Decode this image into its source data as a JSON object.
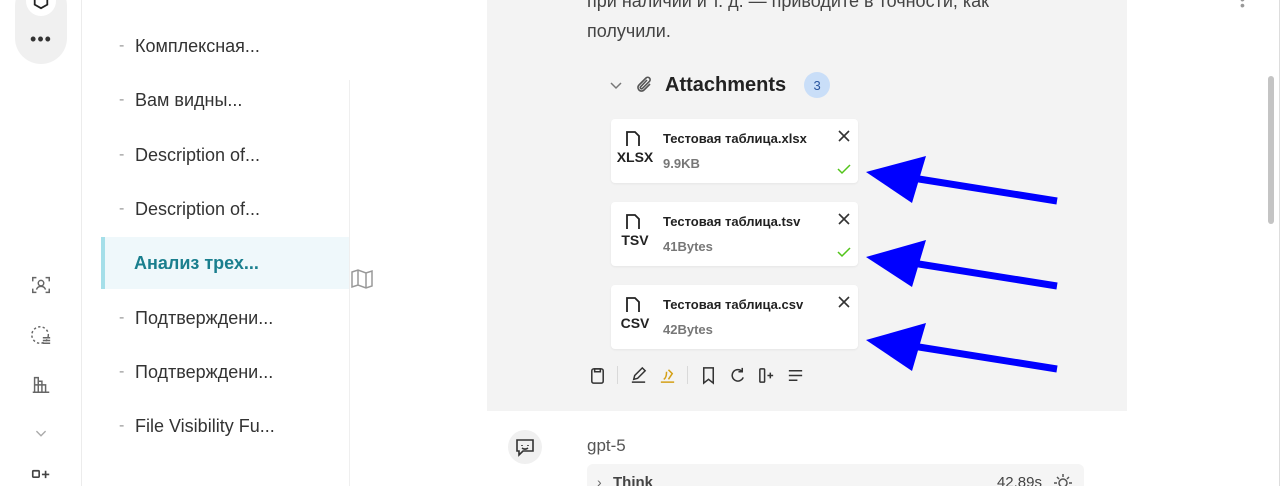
{
  "sidebar": {
    "items": [
      {
        "label": "Комплексная..."
      },
      {
        "label": "Вам видны..."
      },
      {
        "label": "Description of..."
      },
      {
        "label": "Description of..."
      },
      {
        "label": "Анализ трех..."
      },
      {
        "label": "Подтверждени..."
      },
      {
        "label": "Подтверждени..."
      },
      {
        "label": "File Visibility Fu..."
      }
    ],
    "active_index": 4
  },
  "message": {
    "text_line1": "при наличии и т. д. — приводите в точности, как",
    "text_line2": "получили."
  },
  "attachments": {
    "title": "Attachments",
    "count": "3",
    "files": [
      {
        "ext": "XLSX",
        "name": "Тестовая таблица.xlsx",
        "size": "9.9KB",
        "uploaded": true
      },
      {
        "ext": "TSV",
        "name": "Тестовая таблица.tsv",
        "size": "41Bytes",
        "uploaded": true
      },
      {
        "ext": "CSV",
        "name": "Тестовая таблица.csv",
        "size": "42Bytes",
        "uploaded": false
      }
    ]
  },
  "reply": {
    "model": "gpt-5",
    "think_label": "Think",
    "think_time": "42.89s"
  },
  "colors": {
    "accent": "#1a7f8e",
    "active_bg": "#eff8fb",
    "arrow": "#0000ff",
    "check": "#52c41a",
    "badge_bg": "#c9def8"
  },
  "icons": {
    "rail": [
      "person-scan-icon",
      "dashed-list-icon",
      "chart-grid-icon",
      "chevron-down-icon",
      "add-app-icon"
    ],
    "toolbar": [
      "clipboard-icon",
      "edit-icon",
      "translate-icon",
      "bookmark-icon",
      "refresh-icon",
      "branch-icon",
      "text-lines-icon"
    ]
  }
}
